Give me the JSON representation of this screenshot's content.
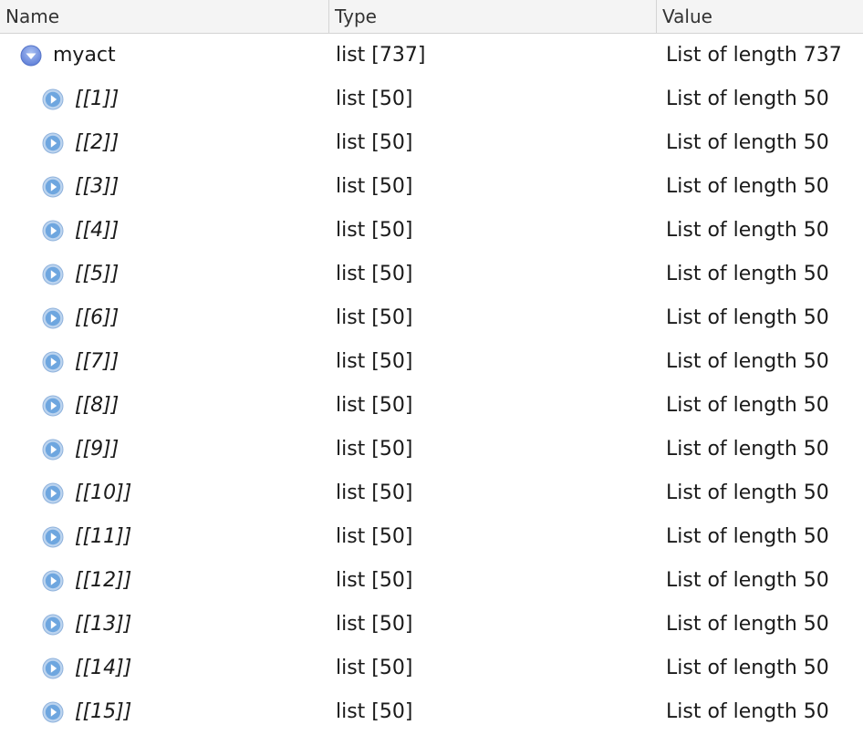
{
  "columns": {
    "name": "Name",
    "type": "Type",
    "value": "Value"
  },
  "colors": {
    "header_bg": "#f4f4f4",
    "toggle_fill": "#6b9fd6",
    "toggle_expanded_fill": "#5f7fd8"
  },
  "root": {
    "name": "myact",
    "type": "list [737]",
    "value": "List of length 737",
    "expanded": true,
    "icon": "chevron-down-icon"
  },
  "items": [
    {
      "name": "[[1]]",
      "type": "list [50]",
      "value": "List of length 50",
      "icon": "chevron-right-icon"
    },
    {
      "name": "[[2]]",
      "type": "list [50]",
      "value": "List of length 50",
      "icon": "chevron-right-icon"
    },
    {
      "name": "[[3]]",
      "type": "list [50]",
      "value": "List of length 50",
      "icon": "chevron-right-icon"
    },
    {
      "name": "[[4]]",
      "type": "list [50]",
      "value": "List of length 50",
      "icon": "chevron-right-icon"
    },
    {
      "name": "[[5]]",
      "type": "list [50]",
      "value": "List of length 50",
      "icon": "chevron-right-icon"
    },
    {
      "name": "[[6]]",
      "type": "list [50]",
      "value": "List of length 50",
      "icon": "chevron-right-icon"
    },
    {
      "name": "[[7]]",
      "type": "list [50]",
      "value": "List of length 50",
      "icon": "chevron-right-icon"
    },
    {
      "name": "[[8]]",
      "type": "list [50]",
      "value": "List of length 50",
      "icon": "chevron-right-icon"
    },
    {
      "name": "[[9]]",
      "type": "list [50]",
      "value": "List of length 50",
      "icon": "chevron-right-icon"
    },
    {
      "name": "[[10]]",
      "type": "list [50]",
      "value": "List of length 50",
      "icon": "chevron-right-icon"
    },
    {
      "name": "[[11]]",
      "type": "list [50]",
      "value": "List of length 50",
      "icon": "chevron-right-icon"
    },
    {
      "name": "[[12]]",
      "type": "list [50]",
      "value": "List of length 50",
      "icon": "chevron-right-icon"
    },
    {
      "name": "[[13]]",
      "type": "list [50]",
      "value": "List of length 50",
      "icon": "chevron-right-icon"
    },
    {
      "name": "[[14]]",
      "type": "list [50]",
      "value": "List of length 50",
      "icon": "chevron-right-icon"
    },
    {
      "name": "[[15]]",
      "type": "list [50]",
      "value": "List of length 50",
      "icon": "chevron-right-icon"
    }
  ]
}
